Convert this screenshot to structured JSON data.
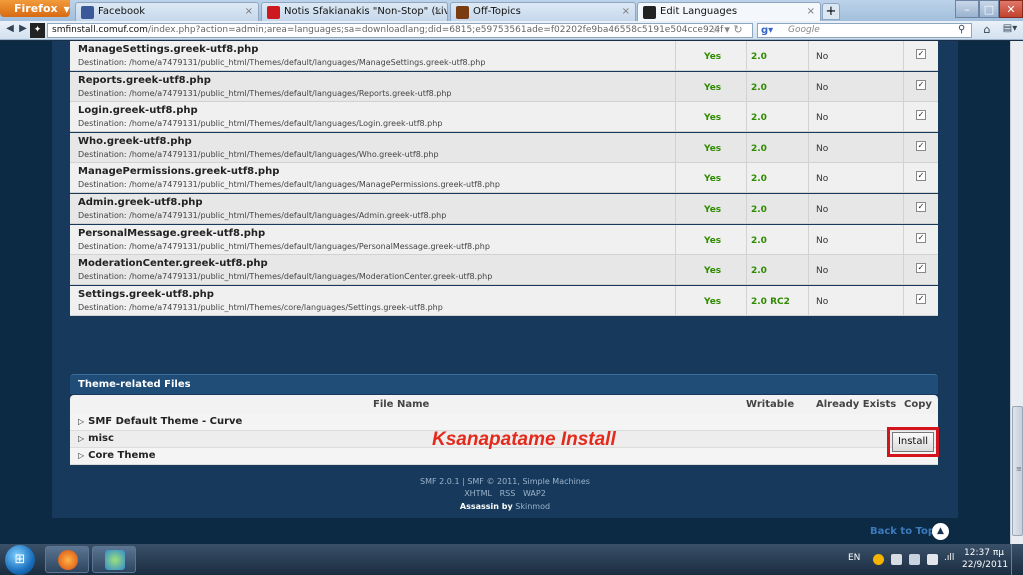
{
  "browser": {
    "menu_label": "Firefox",
    "tabs": [
      {
        "title": "Facebook",
        "icon_color": "#3b5998",
        "close": "×"
      },
      {
        "title": "Notis Sfakianakis \"Non-Stop\" (Live fr...",
        "icon_color": "#cc181e",
        "close": "×"
      },
      {
        "title": "Off-Topics",
        "icon_color": "#7a3d12",
        "close": "×"
      },
      {
        "title": "Edit Languages",
        "icon_color": "#222222",
        "close": "×"
      }
    ],
    "new_tab_label": "+",
    "url_host": "smfinstall.comuf.com",
    "url_rest": "/index.php?action=admin;area=languages;sa=downloadlang;did=6815;e59753561ade=f02202fe9ba46558c5191e504cce924f",
    "search_placeholder": "Google",
    "search_engine_icon": "google-icon"
  },
  "files": [
    {
      "name": "ManageSettings.greek-utf8.php",
      "dest": "Destination: /home/a7479131/public_html/Themes/default/languages/ManageSettings.greek-utf8.php",
      "writable": "Yes",
      "version": "2.0",
      "exists": "No"
    },
    {
      "name": "Reports.greek-utf8.php",
      "dest": "Destination: /home/a7479131/public_html/Themes/default/languages/Reports.greek-utf8.php",
      "writable": "Yes",
      "version": "2.0",
      "exists": "No"
    },
    {
      "name": "Login.greek-utf8.php",
      "dest": "Destination: /home/a7479131/public_html/Themes/default/languages/Login.greek-utf8.php",
      "writable": "Yes",
      "version": "2.0",
      "exists": "No"
    },
    {
      "name": "Who.greek-utf8.php",
      "dest": "Destination: /home/a7479131/public_html/Themes/default/languages/Who.greek-utf8.php",
      "writable": "Yes",
      "version": "2.0",
      "exists": "No"
    },
    {
      "name": "ManagePermissions.greek-utf8.php",
      "dest": "Destination: /home/a7479131/public_html/Themes/default/languages/ManagePermissions.greek-utf8.php",
      "writable": "Yes",
      "version": "2.0",
      "exists": "No"
    },
    {
      "name": "Admin.greek-utf8.php",
      "dest": "Destination: /home/a7479131/public_html/Themes/default/languages/Admin.greek-utf8.php",
      "writable": "Yes",
      "version": "2.0",
      "exists": "No"
    },
    {
      "name": "PersonalMessage.greek-utf8.php",
      "dest": "Destination: /home/a7479131/public_html/Themes/default/languages/PersonalMessage.greek-utf8.php",
      "writable": "Yes",
      "version": "2.0",
      "exists": "No"
    },
    {
      "name": "ModerationCenter.greek-utf8.php",
      "dest": "Destination: /home/a7479131/public_html/Themes/default/languages/ModerationCenter.greek-utf8.php",
      "writable": "Yes",
      "version": "2.0",
      "exists": "No"
    },
    {
      "name": "Settings.greek-utf8.php",
      "dest": "Destination: /home/a7479131/public_html/Themes/core/languages/Settings.greek-utf8.php",
      "writable": "Yes",
      "version": "2.0 RC2",
      "exists": "No"
    }
  ],
  "theme_section": {
    "title": "Theme-related Files",
    "columns": {
      "file_name": "File Name",
      "writable": "Writable",
      "exists": "Already Exists",
      "copy": "Copy"
    },
    "groups": [
      "SMF Default Theme - Curve",
      "misc",
      "Core Theme"
    ]
  },
  "annotation_text": "Ksanapatame Install",
  "install_label": "Install",
  "footer": {
    "line1_a": "SMF 2.0.1",
    "line1_sep": " | ",
    "line1_b": "SMF © 2011, ",
    "line1_c": "Simple Machines",
    "links": [
      "XHTML",
      "RSS",
      "WAP2"
    ],
    "theme_credit": "Assassin by",
    "theme_author": "Skinmod"
  },
  "back_to_top": "Back to Top",
  "taskbar": {
    "lang": "EN",
    "time": "12:37 πμ",
    "date": "22/9/2011"
  },
  "colors": {
    "accent_red": "#e42a1c",
    "yes_green": "#2e8b00",
    "page_bg": "#0d2a44"
  }
}
